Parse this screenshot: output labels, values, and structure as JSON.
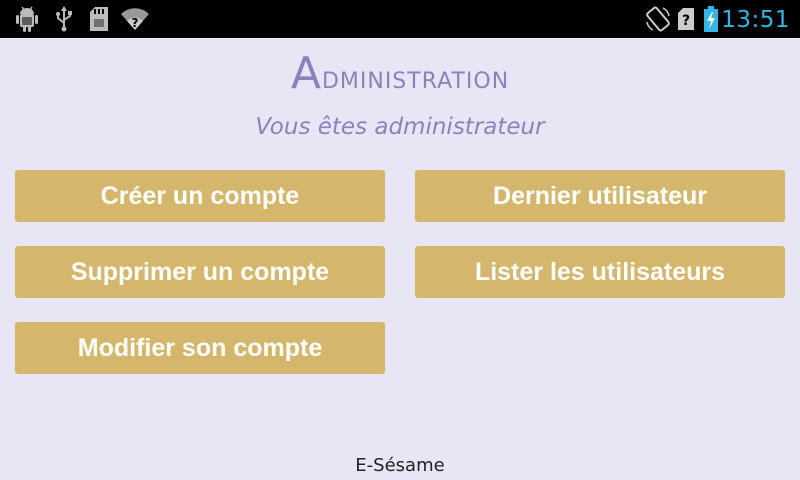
{
  "status_bar": {
    "left_icons": [
      "android-debug-icon",
      "usb-icon",
      "sd-card-icon",
      "wifi-icon"
    ],
    "right_icons": [
      "screen-rotate-icon",
      "no-sim-icon",
      "battery-charging-icon"
    ],
    "time": "13:51",
    "accent_color": "#33b5e5"
  },
  "header": {
    "title_initial": "A",
    "title_rest": "dministration",
    "subtitle": "Vous êtes administrateur",
    "color": "#8585bc"
  },
  "actions": {
    "create_account": "Créer un compte",
    "last_user": "Dernier utilisateur",
    "delete_account": "Supprimer un compte",
    "list_users": "Lister les utilisateurs",
    "edit_own_account": "Modifier son compte",
    "button_color": "#d4b76c"
  },
  "footer": {
    "app_name": "E-Sésame"
  }
}
